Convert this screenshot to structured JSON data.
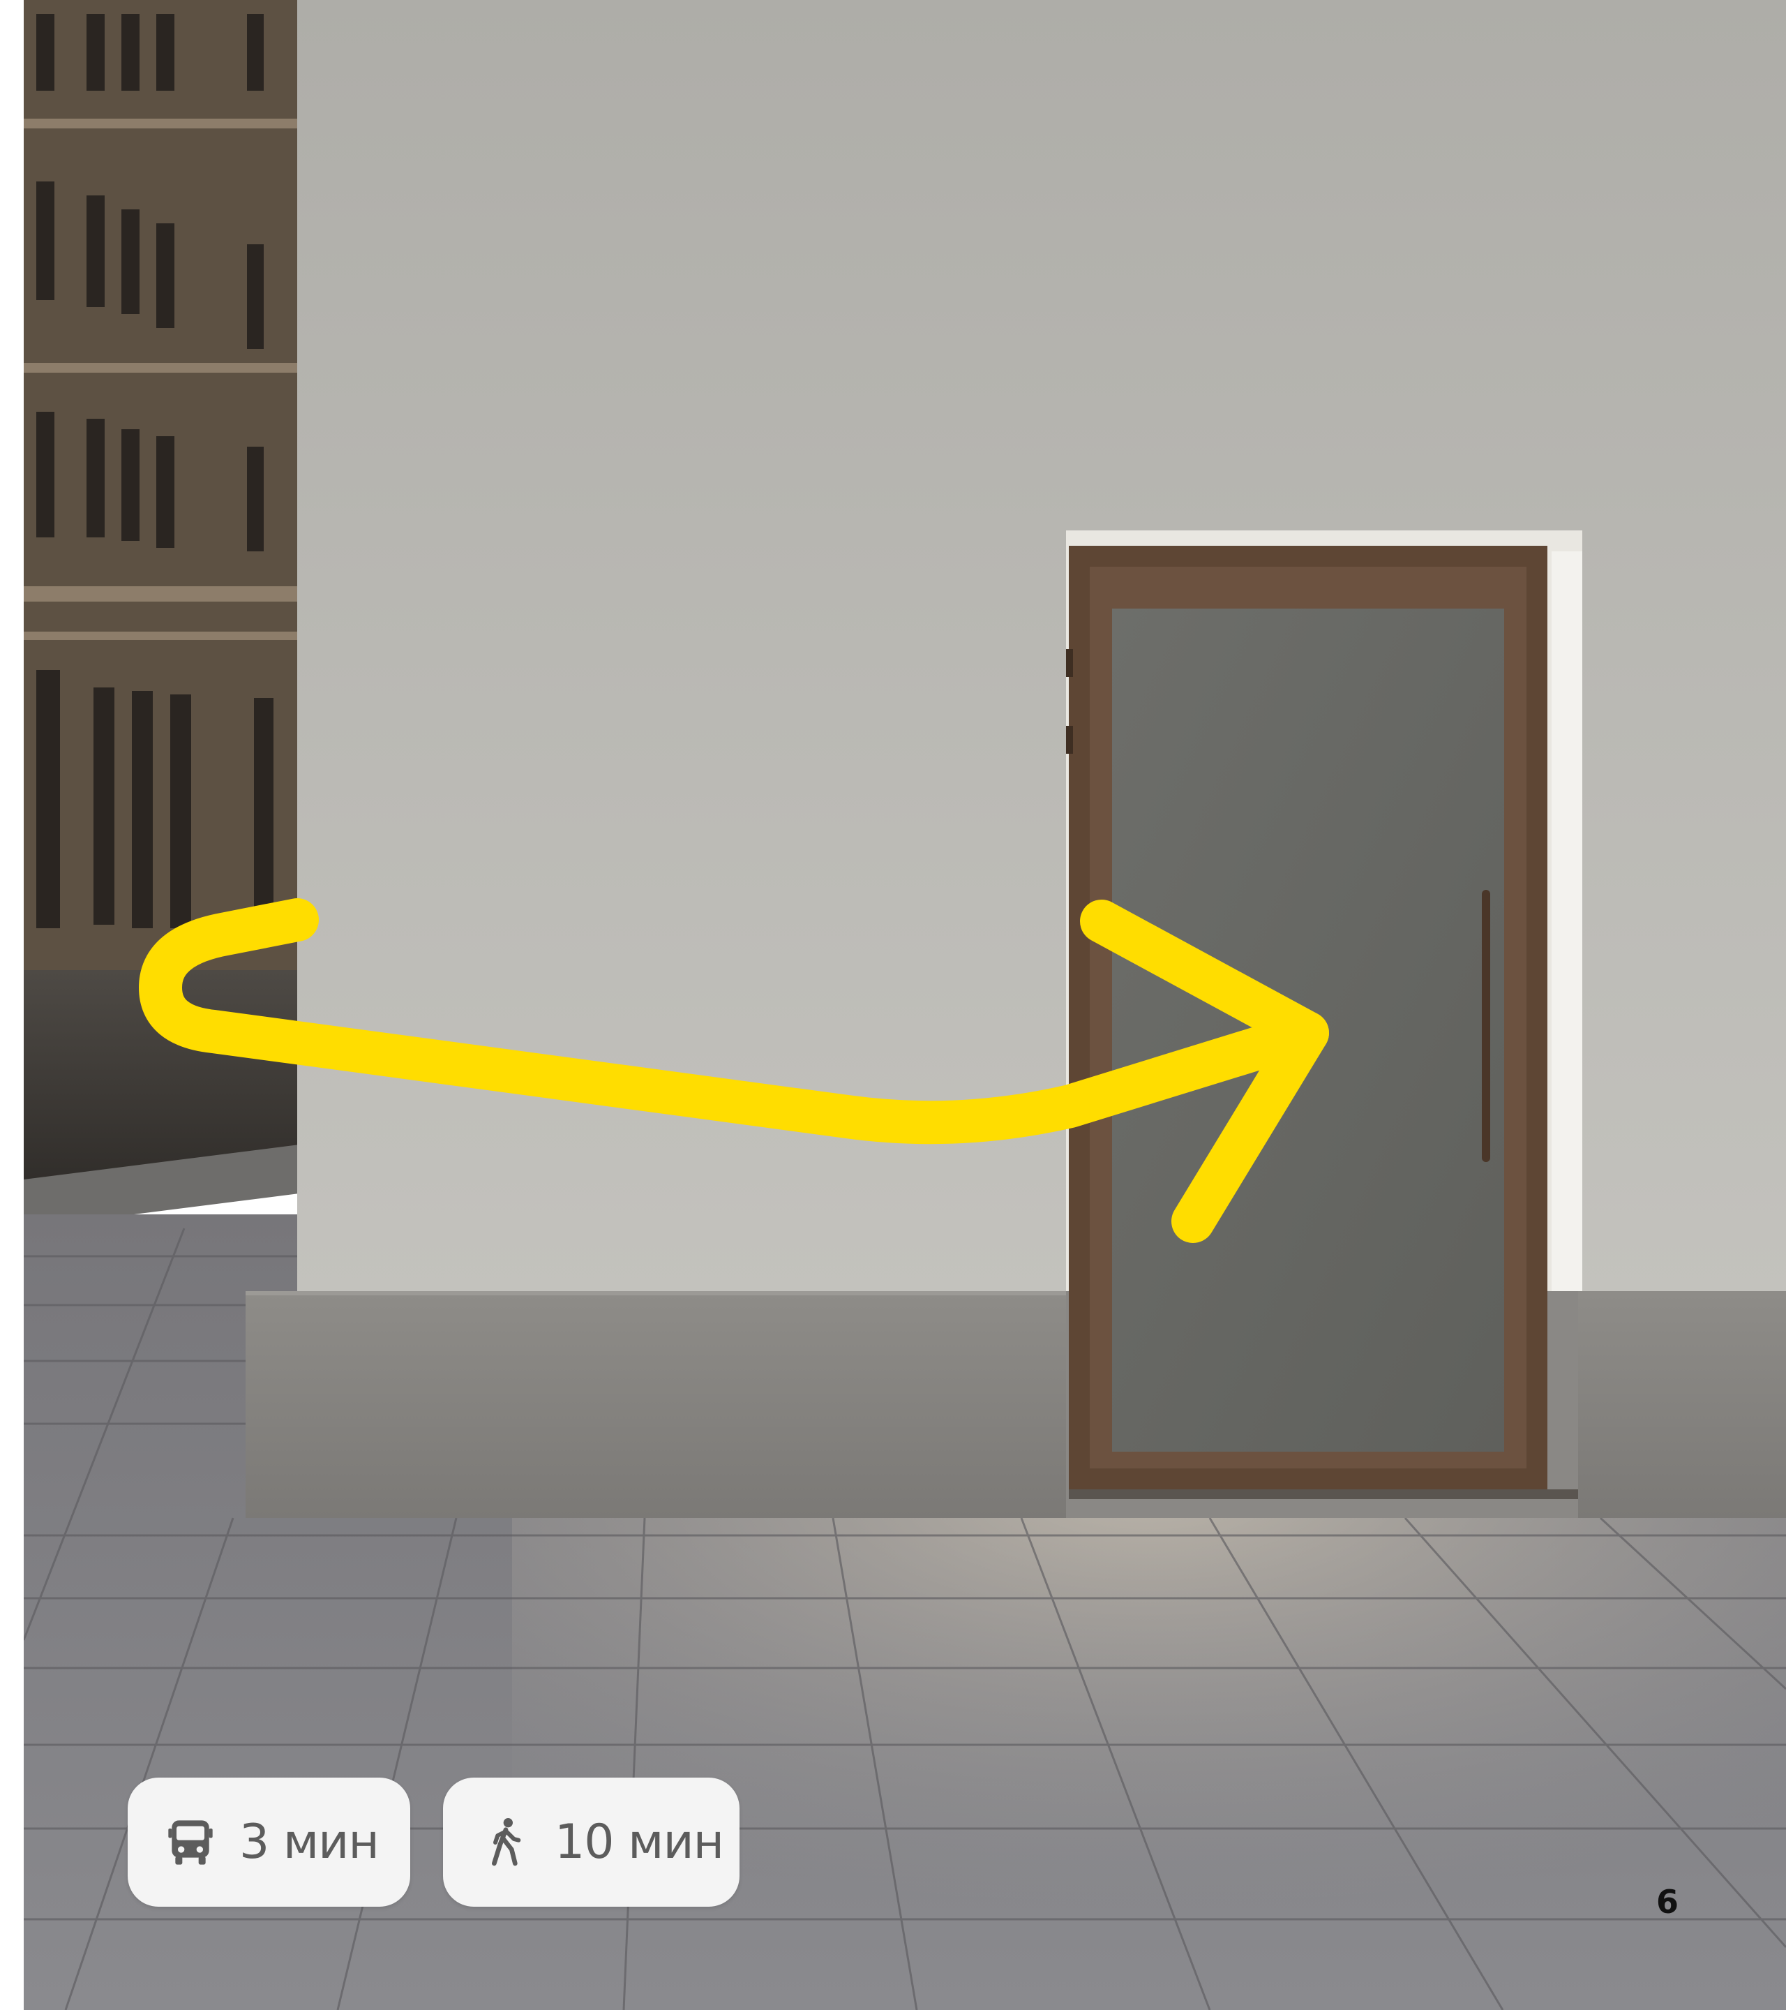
{
  "badges": {
    "bus": {
      "icon": "bus-icon",
      "label": "3 мин"
    },
    "walk": {
      "icon": "pedestrian-icon",
      "label": "10 мин"
    }
  },
  "page": {
    "number": "6"
  },
  "colors": {
    "route_arrow": "#FFDD00",
    "badge_background": "#F4F4F4",
    "badge_text": "#5C5C5C",
    "wall": "#BDBCB7",
    "door_frame": "#5E4634",
    "door_glass": "#6B6C68"
  }
}
